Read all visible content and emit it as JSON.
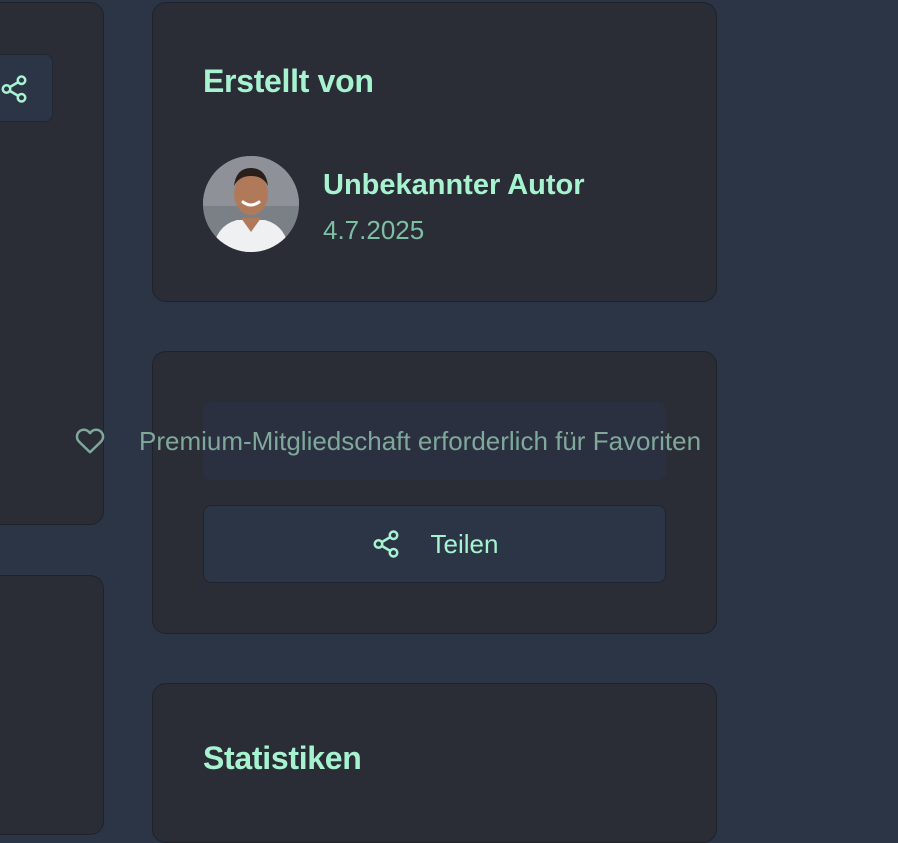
{
  "author_card": {
    "title": "Erstellt von",
    "author_name": "Unbekannter Autor",
    "date": "4.7.2025"
  },
  "actions": {
    "favorite_notice": "Premium-Mitgliedschaft erforderlich für Favoriten",
    "share_label": "Teilen"
  },
  "stats_card": {
    "title": "Statistiken"
  },
  "colors": {
    "accent": "#a7f3d0",
    "muted_accent": "#7dbfa3",
    "card_bg": "#2a2d36",
    "page_bg": "#2b3545"
  },
  "icons": {
    "share": "share-icon",
    "favorite": "heart-icon"
  }
}
